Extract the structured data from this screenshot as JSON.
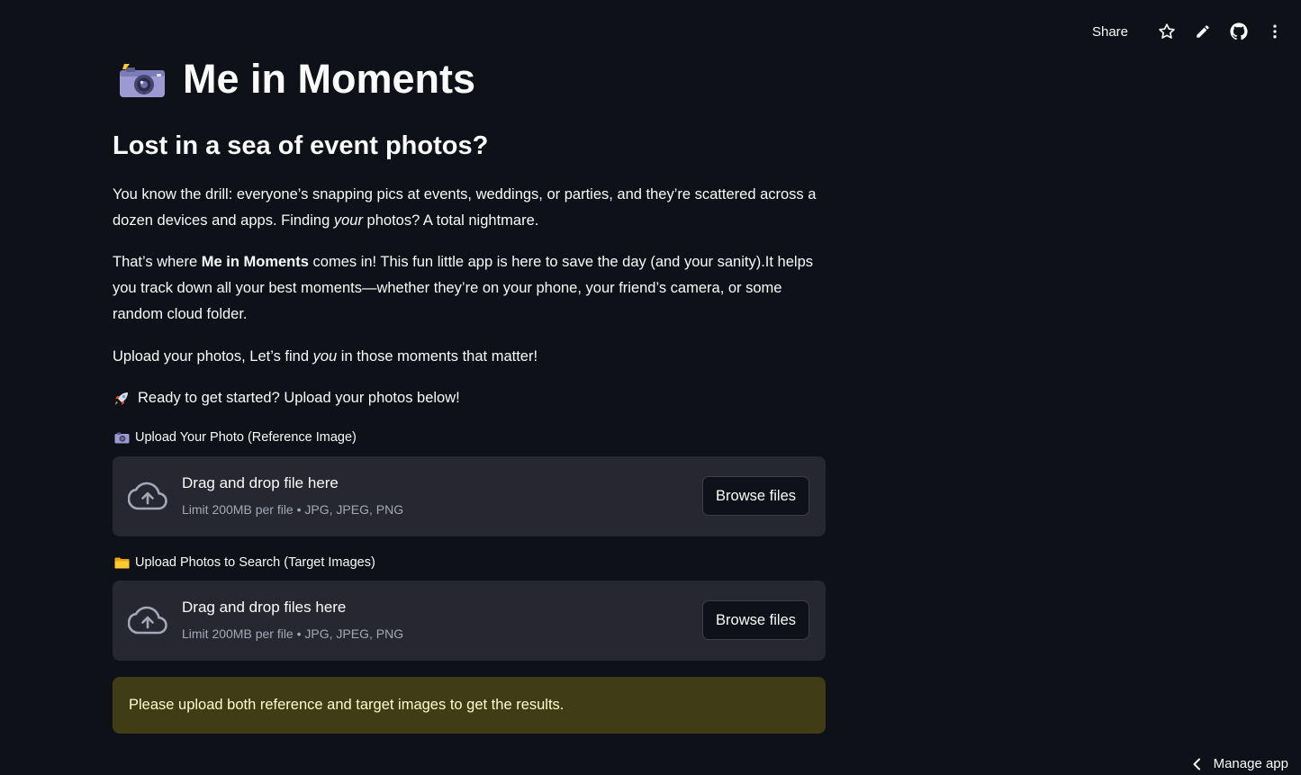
{
  "header": {
    "share_label": "Share",
    "icons": [
      "star-icon",
      "pencil-icon",
      "github-icon",
      "more-vertical-icon"
    ]
  },
  "app": {
    "title_emoji": "camera-with-flash-icon",
    "title": "Me in Moments",
    "subtitle": "Lost in a sea of event photos?"
  },
  "intro": {
    "p1_part1": "You know the drill: everyone’s snapping pics at events, weddings, or parties, and they’re scattered across a dozen devices and apps. Finding ",
    "p1_em": "your",
    "p1_part2": " photos? A total nightmare.",
    "p2_part1": "That’s where ",
    "p2_strong": "Me in Moments",
    "p2_part2": " comes in! This fun little app is here to save the day (and your sanity).It helps you track down all your best moments—whether they’re on your phone, your friend’s camera, or some random cloud folder.",
    "p3_part1": "Upload your photos, Let’s find ",
    "p3_em": "you",
    "p3_part2": " in those moments that matter!",
    "p4": "Ready to get started? Upload your photos below!"
  },
  "reference_uploader": {
    "label": "Upload Your Photo (Reference Image)",
    "drop_title": "Drag and drop file here",
    "limit": "Limit 200MB per file • JPG, JPEG, PNG",
    "button": "Browse files"
  },
  "target_uploader": {
    "label": "Upload Photos to Search (Target Images)",
    "drop_title": "Drag and drop files here",
    "limit": "Limit 200MB per file • JPG, JPEG, PNG",
    "button": "Browse files"
  },
  "warning": {
    "text": "Please upload both reference and target images to get the results."
  },
  "footer": {
    "manage_app": "Manage app"
  },
  "colors": {
    "background": "#0e1117",
    "dropzone": "#262730",
    "warning_bg": "#3f3c16",
    "warning_text": "#fffbcc",
    "muted_text": "#a3a8b8"
  }
}
